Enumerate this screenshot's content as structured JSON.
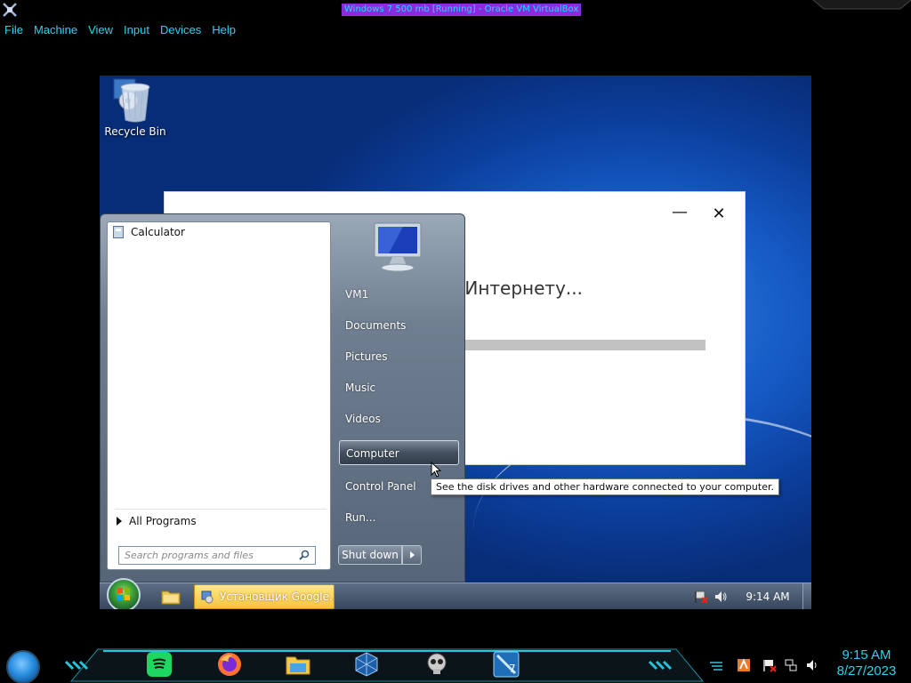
{
  "host": {
    "window_title": "Windows 7 500 mb [Running] - Oracle VM VirtualBox",
    "menu": [
      "File",
      "Machine",
      "View",
      "Input",
      "Devices",
      "Help"
    ],
    "clock_time": "9:15 AM",
    "clock_date": "8/27/2023",
    "dock_icons": [
      "spotify-icon",
      "firefox-icon",
      "file-explorer-icon",
      "virtualbox-icon",
      "skull-app-icon",
      "windows7-vm-icon"
    ]
  },
  "guest": {
    "desktop_icons": [
      {
        "label": "Recycle Bin",
        "icon": "recycle-bin-icon"
      }
    ],
    "installer": {
      "status_text": "к Интернету...",
      "progress": 0.0
    },
    "start_menu": {
      "programs": [
        {
          "label": "Calculator",
          "icon": "calculator-icon"
        }
      ],
      "all_programs": "All Programs",
      "search_placeholder": "Search programs and files",
      "right_items": [
        "VM1",
        "Documents",
        "Pictures",
        "Music",
        "Videos",
        "Computer",
        "Control Panel",
        "Run..."
      ],
      "highlighted": "Computer",
      "shutdown_label": "Shut down",
      "tooltip": "See the disk drives and other hardware connected to your computer."
    },
    "taskbar": {
      "task_label": "Установщик Google...",
      "clock": "9:14 AM"
    }
  }
}
